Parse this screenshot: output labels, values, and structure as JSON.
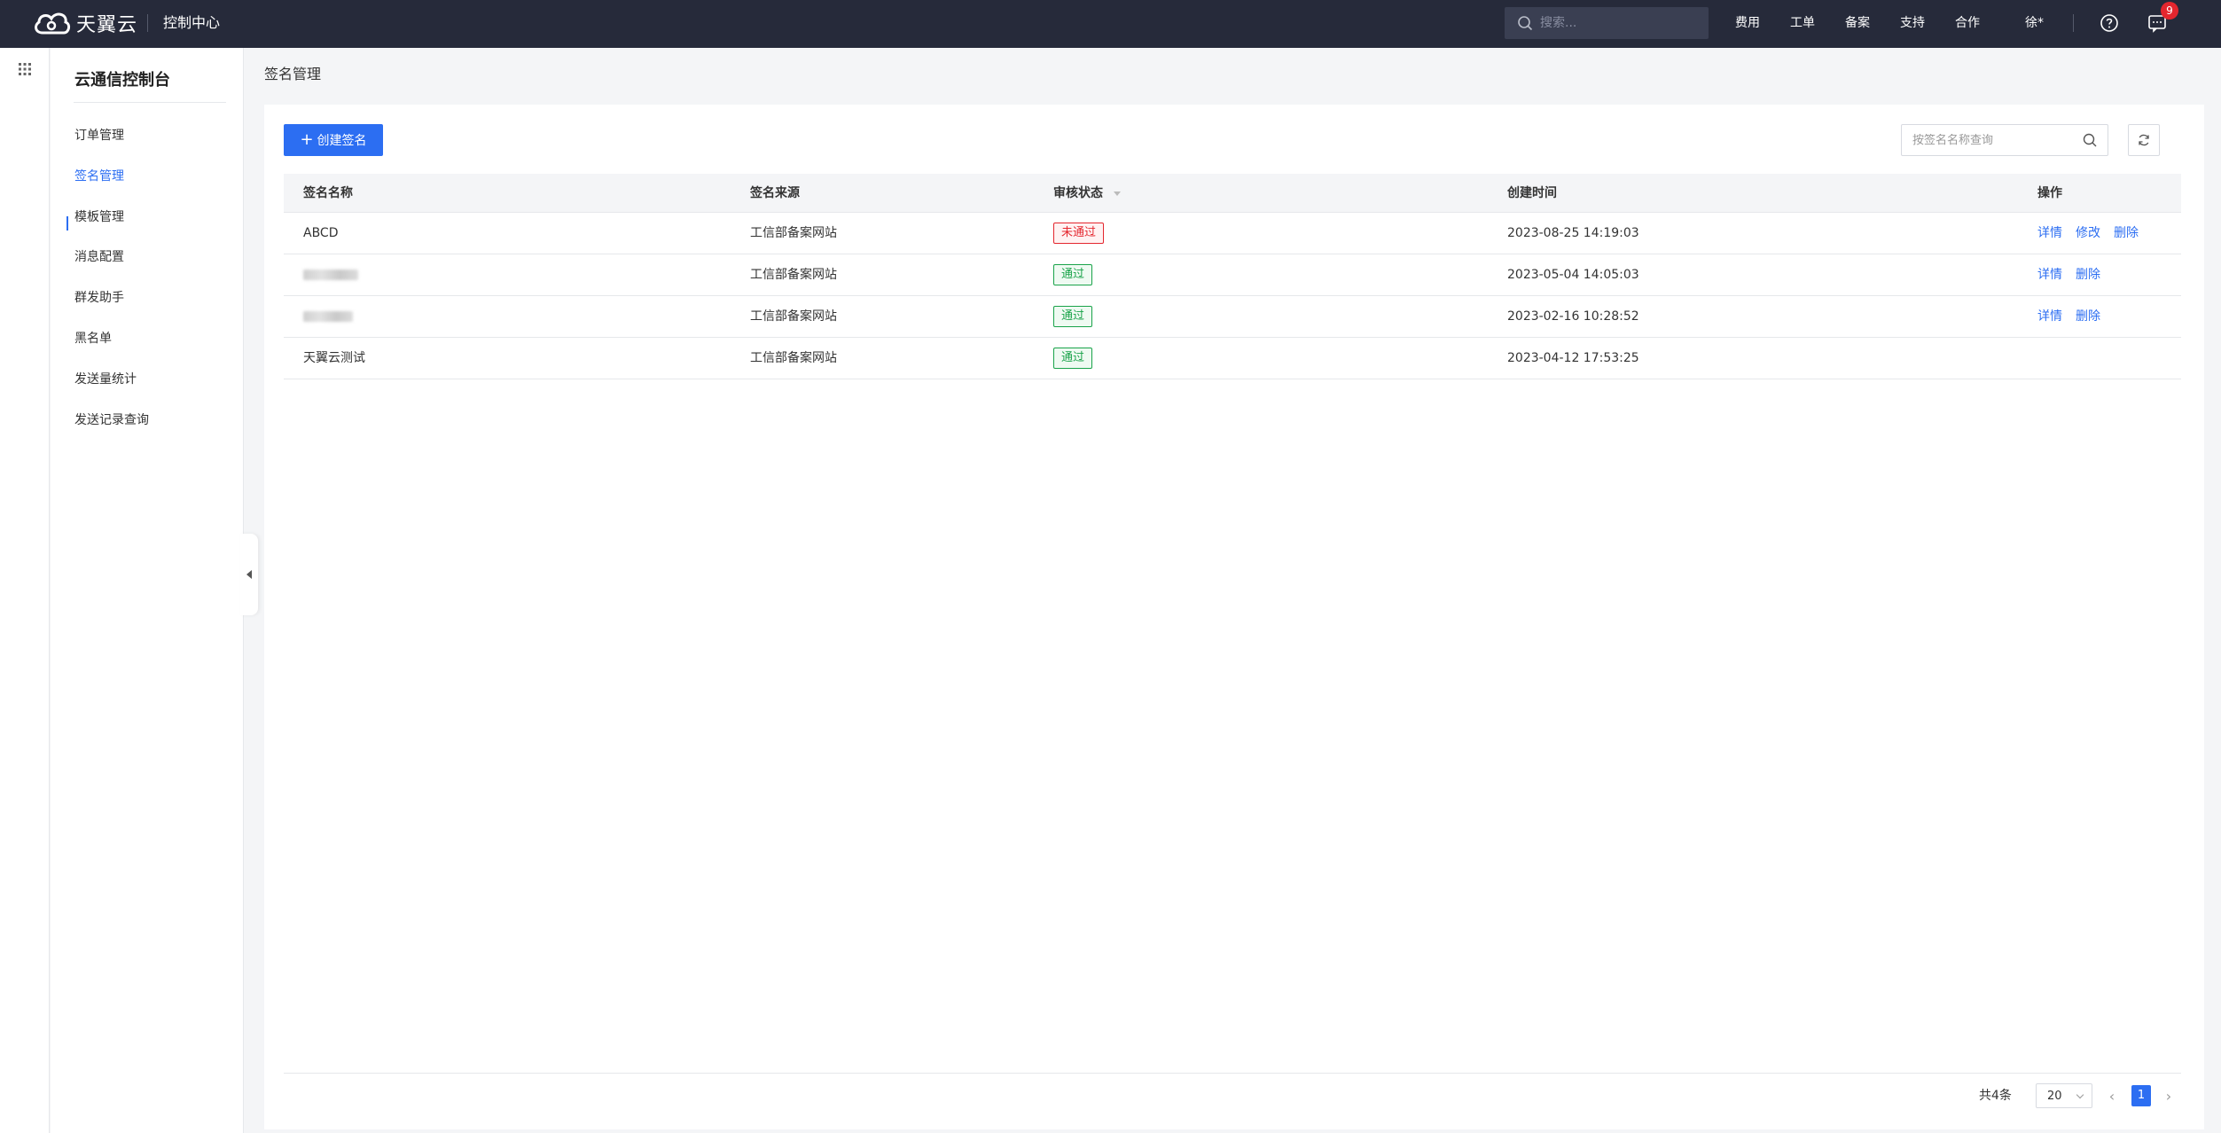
{
  "header": {
    "logo_text": "天翼云",
    "console_title": "控制中心",
    "search_placeholder": "搜索...",
    "nav": [
      "费用",
      "工单",
      "备案",
      "支持",
      "合作"
    ],
    "user": "徐*",
    "notification_count": "9"
  },
  "sidebar": {
    "title": "云通信控制台",
    "items": [
      {
        "label": "订单管理"
      },
      {
        "label": "签名管理"
      },
      {
        "label": "模板管理"
      },
      {
        "label": "消息配置"
      },
      {
        "label": "群发助手"
      },
      {
        "label": "黑名单"
      },
      {
        "label": "发送量统计"
      },
      {
        "label": "发送记录查询"
      }
    ],
    "active_index": 1
  },
  "main": {
    "breadcrumb": "签名管理",
    "create_button": "创建签名",
    "search_placeholder": "按签名名称查询"
  },
  "table": {
    "columns": [
      "签名名称",
      "签名来源",
      "审核状态",
      "创建时间",
      "操作"
    ],
    "rows": [
      {
        "name": "ABCD",
        "source": "工信部备案网站",
        "status": "未通过",
        "status_type": "fail",
        "created": "2023-08-25 14:19:03",
        "actions": [
          "详情",
          "修改",
          "删除"
        ]
      },
      {
        "name": "",
        "source": "工信部备案网站",
        "status": "通过",
        "status_type": "pass",
        "created": "2023-05-04 14:05:03",
        "actions": [
          "详情",
          "删除"
        ]
      },
      {
        "name": "",
        "source": "工信部备案网站",
        "status": "通过",
        "status_type": "pass",
        "created": "2023-02-16 10:28:52",
        "actions": [
          "详情",
          "删除"
        ]
      },
      {
        "name": "天翼云测试",
        "source": "工信部备案网站",
        "status": "通过",
        "status_type": "pass",
        "created": "2023-04-12 17:53:25",
        "actions": []
      }
    ]
  },
  "pagination": {
    "total": "共4条",
    "page_size": "20",
    "current_page": "1"
  },
  "colors": {
    "primary": "#2c6ef2",
    "topbar": "#262a3a",
    "fail": "#e4262e",
    "pass": "#1aa34a"
  }
}
